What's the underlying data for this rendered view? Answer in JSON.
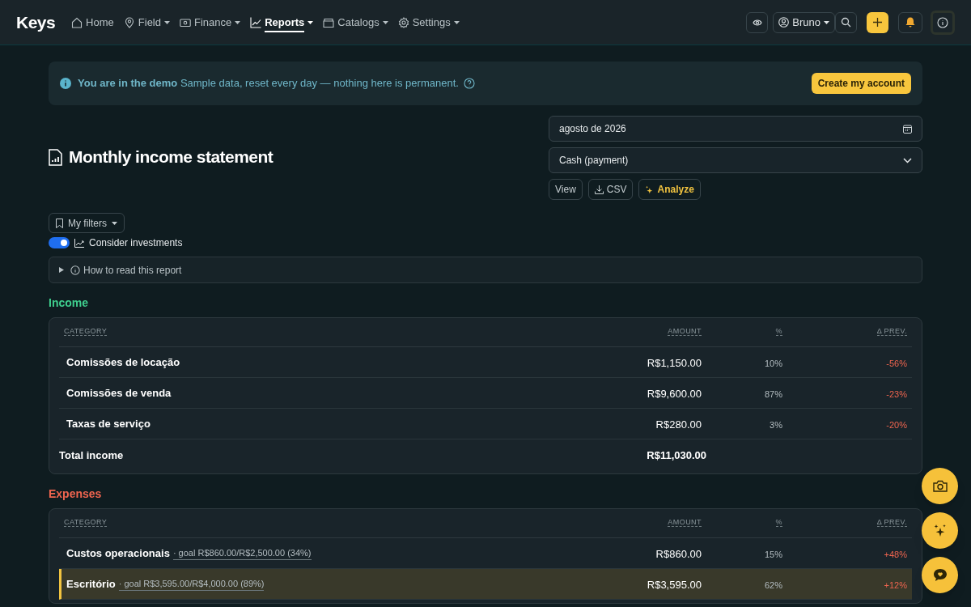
{
  "brand": "Keys",
  "nav": [
    {
      "label": "Home",
      "dropdown": false,
      "selected": false
    },
    {
      "label": "Field",
      "dropdown": true,
      "selected": false
    },
    {
      "label": "Finance",
      "dropdown": true,
      "selected": false
    },
    {
      "label": "Reports",
      "dropdown": true,
      "selected": true
    },
    {
      "label": "Catalogs",
      "dropdown": true,
      "selected": false
    },
    {
      "label": "Settings",
      "dropdown": true,
      "selected": false
    }
  ],
  "user": {
    "name": "Bruno"
  },
  "banner": {
    "title": "You are in the demo",
    "text": "Sample data, reset every day — nothing here is permanent.",
    "button": "Create my account"
  },
  "page_title": "Monthly income statement",
  "month_field": {
    "value": "agosto de 2026"
  },
  "basis_select": {
    "value": "Cash (payment)"
  },
  "actions": [
    {
      "label": "View",
      "kind": "plain"
    },
    {
      "label": "CSV",
      "kind": "download"
    },
    {
      "label": "Analyze",
      "kind": "ai"
    }
  ],
  "filters_button": "My filters",
  "investments_toggle": {
    "label": "Consider investments",
    "on": true
  },
  "help": {
    "label": "How to read this report",
    "expanded": false
  },
  "sections": [
    {
      "title": "Income",
      "kind": "income",
      "columns": [
        "CATEGORY",
        "AMOUNT",
        "%",
        "Δ PREV."
      ],
      "rows": [
        {
          "category": "Comissões de locação",
          "amount": "R$1,150.00",
          "percent": "10%",
          "delta": "-56%",
          "highlighted": false
        },
        {
          "category": "Comissões de venda",
          "amount": "R$9,600.00",
          "percent": "87%",
          "delta": "-23%",
          "highlighted": false
        },
        {
          "category": "Taxas de serviço",
          "amount": "R$280.00",
          "percent": "3%",
          "delta": "-20%",
          "highlighted": false
        }
      ],
      "total": {
        "label": "Total income",
        "amount": "R$11,030.00"
      }
    },
    {
      "title": "Expenses",
      "kind": "expense",
      "columns": [
        "CATEGORY",
        "AMOUNT",
        "%",
        "Δ PREV."
      ],
      "rows": [
        {
          "category": "Custos operacionais",
          "goal": "· goal R$860.00/R$2,500.00 (34%)",
          "amount": "R$860.00",
          "percent": "15%",
          "delta": "+48%",
          "highlighted": false
        },
        {
          "category": "Escritório",
          "goal": "· goal R$3,595.00/R$4,000.00 (89%)",
          "amount": "R$3,595.00",
          "percent": "62%",
          "delta": "+12%",
          "highlighted": true
        }
      ]
    }
  ]
}
